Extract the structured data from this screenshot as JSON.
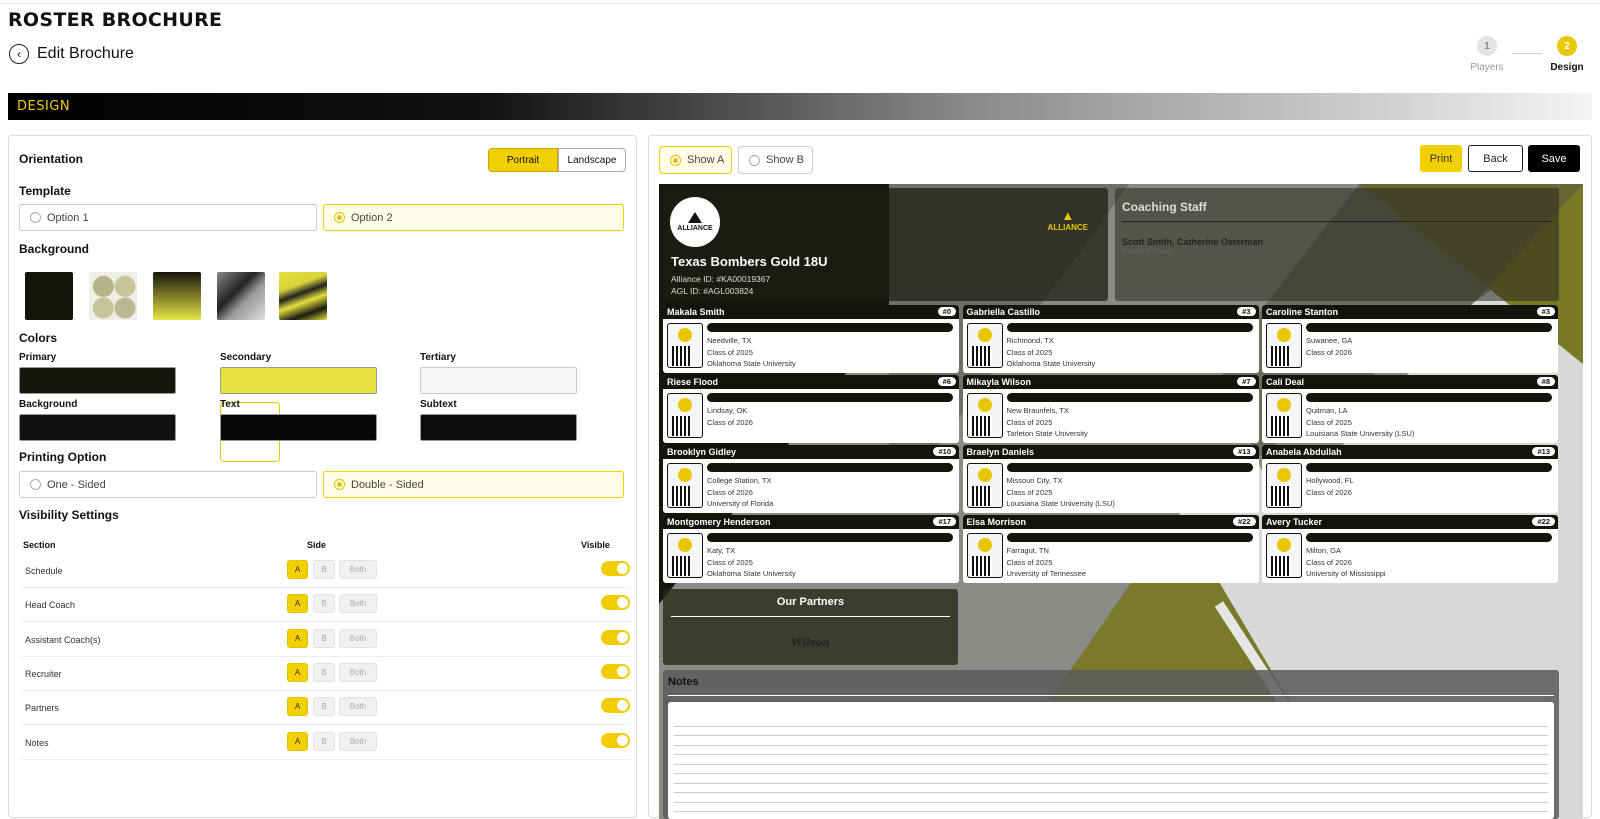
{
  "app": {
    "brand": "ROSTER BROCHURE",
    "back_label": "Edit Brochure",
    "banner": "DESIGN"
  },
  "stepper": [
    {
      "num": "1",
      "label": "Players"
    },
    {
      "num": "2",
      "label": "Design"
    }
  ],
  "panel": {
    "orientation": {
      "label": "Orientation",
      "options": [
        "Portrait",
        "Landscape"
      ],
      "selected": "Portrait"
    },
    "template": {
      "label": "Template",
      "options": [
        "Option 1",
        "Option 2"
      ],
      "selected": "Option 2"
    },
    "background": {
      "label": "Background",
      "selected_index": 3
    },
    "colors": {
      "label": "Colors",
      "fields": [
        {
          "label": "Primary",
          "value": "#15150b"
        },
        {
          "label": "Secondary",
          "value": "#e6e23d"
        },
        {
          "label": "Tertiary",
          "value": "#f6f6f6"
        },
        {
          "label": "Background",
          "value": "#111111"
        },
        {
          "label": "Text",
          "value": "#060606"
        },
        {
          "label": "Subtext",
          "value": "#0b0b0b"
        }
      ]
    },
    "printing": {
      "label": "Printing Option",
      "options": [
        "One - Sided",
        "Double - Sided"
      ],
      "selected": "Double - Sided"
    },
    "visibility": {
      "label": "Visibility Settings",
      "headers": [
        "Section",
        "Side",
        "Visible"
      ],
      "side_options": [
        "A",
        "B",
        "Both"
      ],
      "rows": [
        {
          "section": "Schedule",
          "side": "A",
          "visible": true
        },
        {
          "section": "Head Coach",
          "side": "A",
          "visible": true
        },
        {
          "section": "Assistant Coach(s)",
          "side": "A",
          "visible": true
        },
        {
          "section": "Recruiter",
          "side": "A",
          "visible": true
        },
        {
          "section": "Partners",
          "side": "A",
          "visible": true
        },
        {
          "section": "Notes",
          "side": "A",
          "visible": true
        }
      ]
    }
  },
  "preview": {
    "show_options": [
      "Show A",
      "Show B"
    ],
    "selected_show": "Show A",
    "actions": {
      "print": "Print",
      "back": "Back",
      "save": "Save"
    },
    "team": {
      "logo_text": "ALLIANCE",
      "name": "Texas Bombers Gold 18U",
      "alliance_id": "Alliance ID: #KA00019367",
      "agl_id": "AGL ID: #AGL003824"
    },
    "coaching": {
      "title": "Coaching Staff",
      "names": "Scott Smith, Catherine Osterman",
      "role": "Assistant Coach"
    },
    "players": [
      {
        "name": "Makala Smith",
        "number": "#0",
        "lines": [
          "Needville, TX",
          "Class of 2025",
          "Oklahoma State University"
        ]
      },
      {
        "name": "Gabriella Castillo",
        "number": "#3",
        "lines": [
          "Richmond, TX",
          "Class of 2025",
          "Oklahoma State University"
        ]
      },
      {
        "name": "Caroline Stanton",
        "number": "#3",
        "lines": [
          "Suwanee, GA",
          "Class of 2026",
          ""
        ]
      },
      {
        "name": "Riese Flood",
        "number": "#6",
        "lines": [
          "Lindsay, OK",
          "Class of 2026",
          ""
        ]
      },
      {
        "name": "Mikayla Wilson",
        "number": "#7",
        "lines": [
          "New Braunfels, TX",
          "Class of 2025",
          "Tarleton State University"
        ]
      },
      {
        "name": "Cali Deal",
        "number": "#8",
        "lines": [
          "Quitman, LA",
          "Class of 2025",
          "Louisiana State University (LSU)"
        ]
      },
      {
        "name": "Brooklyn Gidley",
        "number": "#10",
        "lines": [
          "College Station, TX",
          "Class of 2026",
          "University of Florida"
        ]
      },
      {
        "name": "Braelyn Daniels",
        "number": "#13",
        "lines": [
          "Missouri City, TX",
          "Class of 2025",
          "Louisiana State University (LSU)"
        ]
      },
      {
        "name": "Anabela Abdullah",
        "number": "#13",
        "lines": [
          "Hollywood, FL",
          "Class of 2026",
          ""
        ]
      },
      {
        "name": "Montgomery Henderson",
        "number": "#17",
        "lines": [
          "Katy, TX",
          "Class of 2025",
          "Oklahoma State University"
        ]
      },
      {
        "name": "Elsa Morrison",
        "number": "#22",
        "lines": [
          "Farragut, TN",
          "Class of 2025",
          "University of Tennessee"
        ]
      },
      {
        "name": "Avery Tucker",
        "number": "#22",
        "lines": [
          "Milton, GA",
          "Class of 2026",
          "University of Mississippi"
        ]
      }
    ],
    "partners": {
      "title": "Our Partners",
      "logo": "Wilson"
    },
    "notes": {
      "title": "Notes"
    }
  }
}
